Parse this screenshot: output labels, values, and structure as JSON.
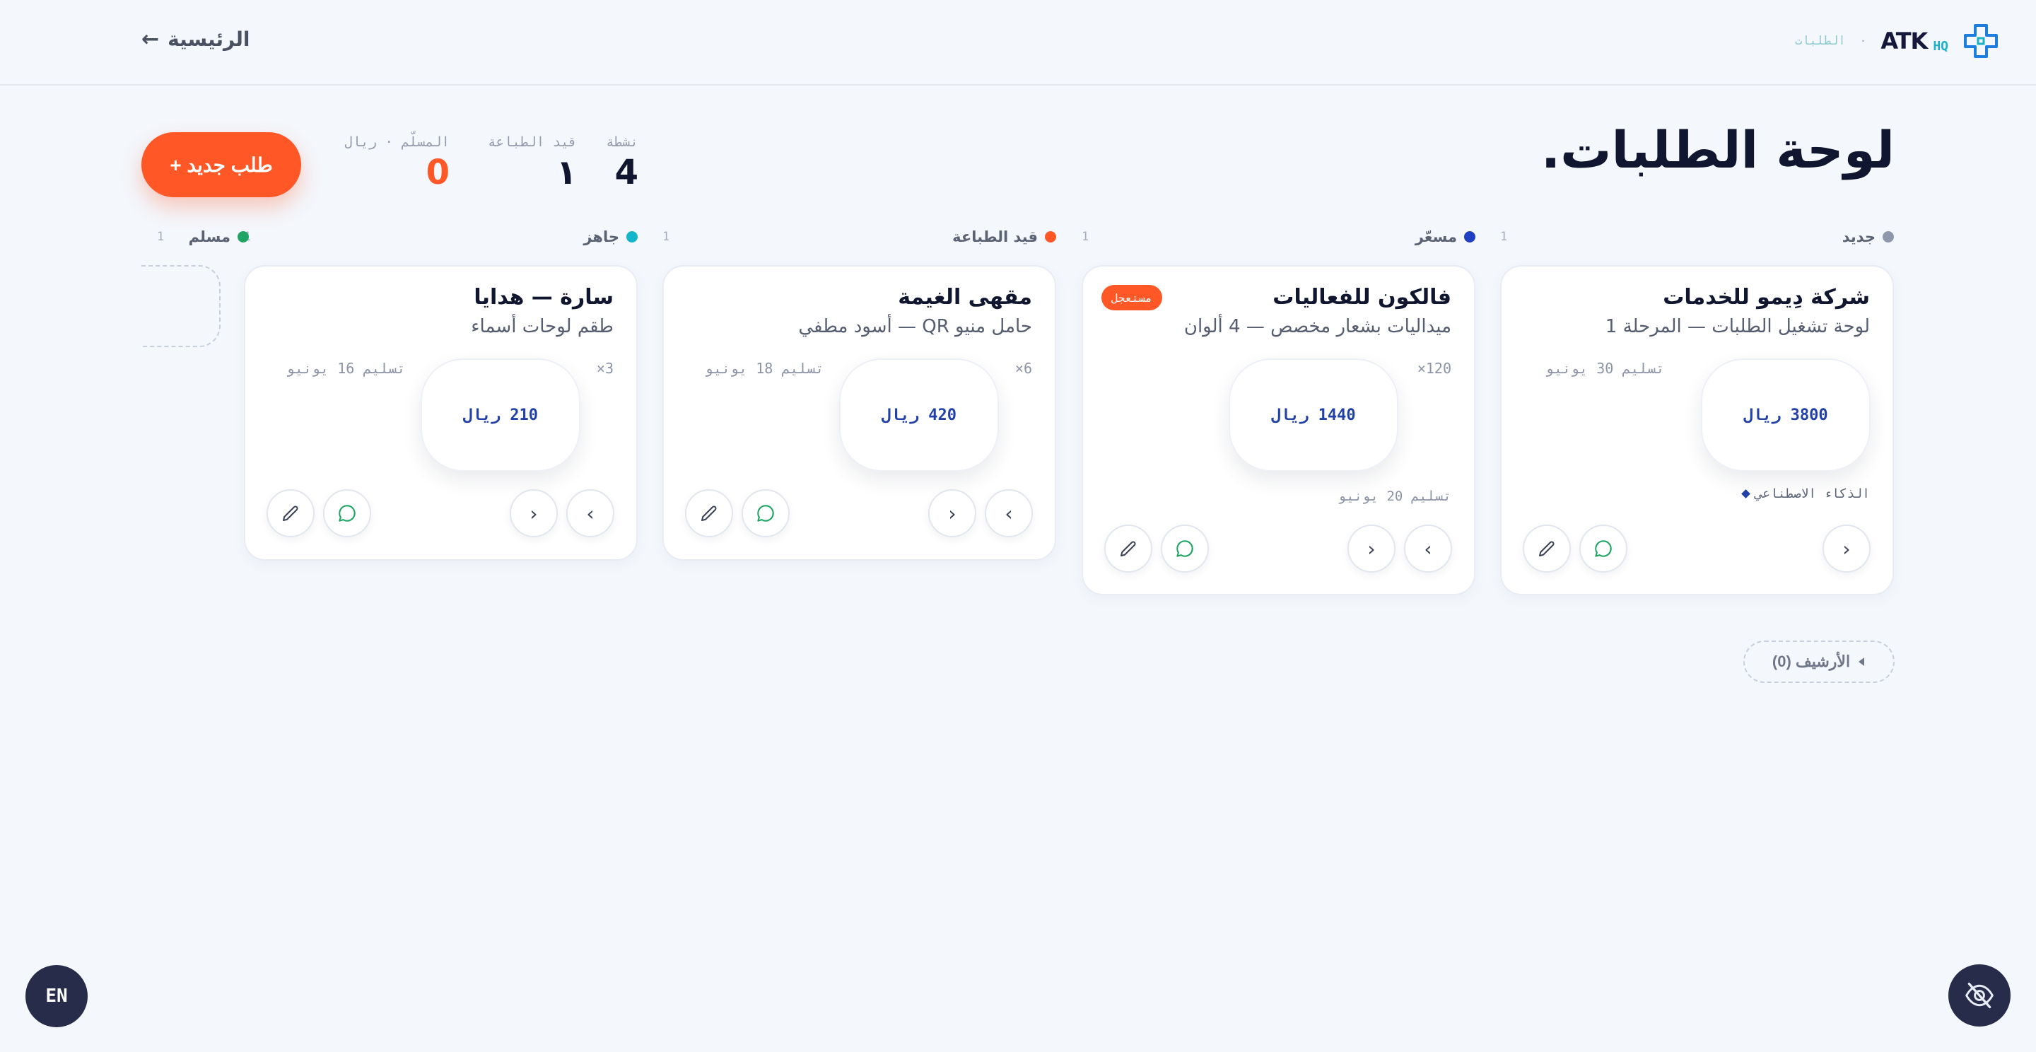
{
  "header": {
    "back_label": "الرئيسية",
    "back_arrow": "←",
    "brand_name": "ATK",
    "brand_suffix": "HQ",
    "separator": "·",
    "crumb": "الطلبات"
  },
  "page": {
    "title": "لوحة الطلبات.",
    "new_order_label": "+ طلب جديد"
  },
  "stats": [
    {
      "label": "نشطة",
      "value": "4"
    },
    {
      "label": "قيد الطباعة",
      "value": "١"
    },
    {
      "label": "المسلّم · ريال",
      "value": "0"
    }
  ],
  "columns": [
    {
      "title": "جديد",
      "count": "1",
      "color": "#8e97ab"
    },
    {
      "title": "مسعّر",
      "count": "1",
      "color": "#1f3fc4"
    },
    {
      "title": "قيد الطباعة",
      "count": "1",
      "color": "#ff5726"
    },
    {
      "title": "جاهز",
      "count": "1",
      "color": "#12b5c9"
    },
    {
      "title": "مسلم",
      "count": "1",
      "color": "#1fa463"
    }
  ],
  "cards": [
    {
      "title": "شركة دِيمو للخدمات",
      "subtitle": "لوحة تشغيل الطلبات — المرحلة 1",
      "qty": "",
      "date": "تسليم 30 يونيو",
      "price": "3800 ريال",
      "tag": "الذكاء الاصطناعي"
    },
    {
      "title": "فالكون للفعاليات",
      "subtitle": "ميداليات بشعار مخصص — 4 ألوان",
      "qty": "×120",
      "badge": "مستعجل",
      "price": "1440 ريال",
      "date": "تسليم 20 يونيو"
    },
    {
      "title": "مقهى الغيمة",
      "subtitle": "حامل منيو QR — أسود مطفي",
      "qty": "×6",
      "date": "تسليم 18 يونيو",
      "price": "420 ريال"
    },
    {
      "title": "سارة — هدايا",
      "subtitle": "طقم لوحات أسماء",
      "qty": "×3",
      "date": "تسليم 16 يونيو",
      "price": "210 ريال"
    }
  ],
  "nav": {
    "prev": "‹",
    "next": "›"
  },
  "archive_label": "الأرشيف (0)",
  "lang_label": "EN",
  "colors": {
    "accent": "#ff5726",
    "navy": "#262c4a",
    "price": "#2140a8",
    "whatsapp": "#1fa463"
  }
}
